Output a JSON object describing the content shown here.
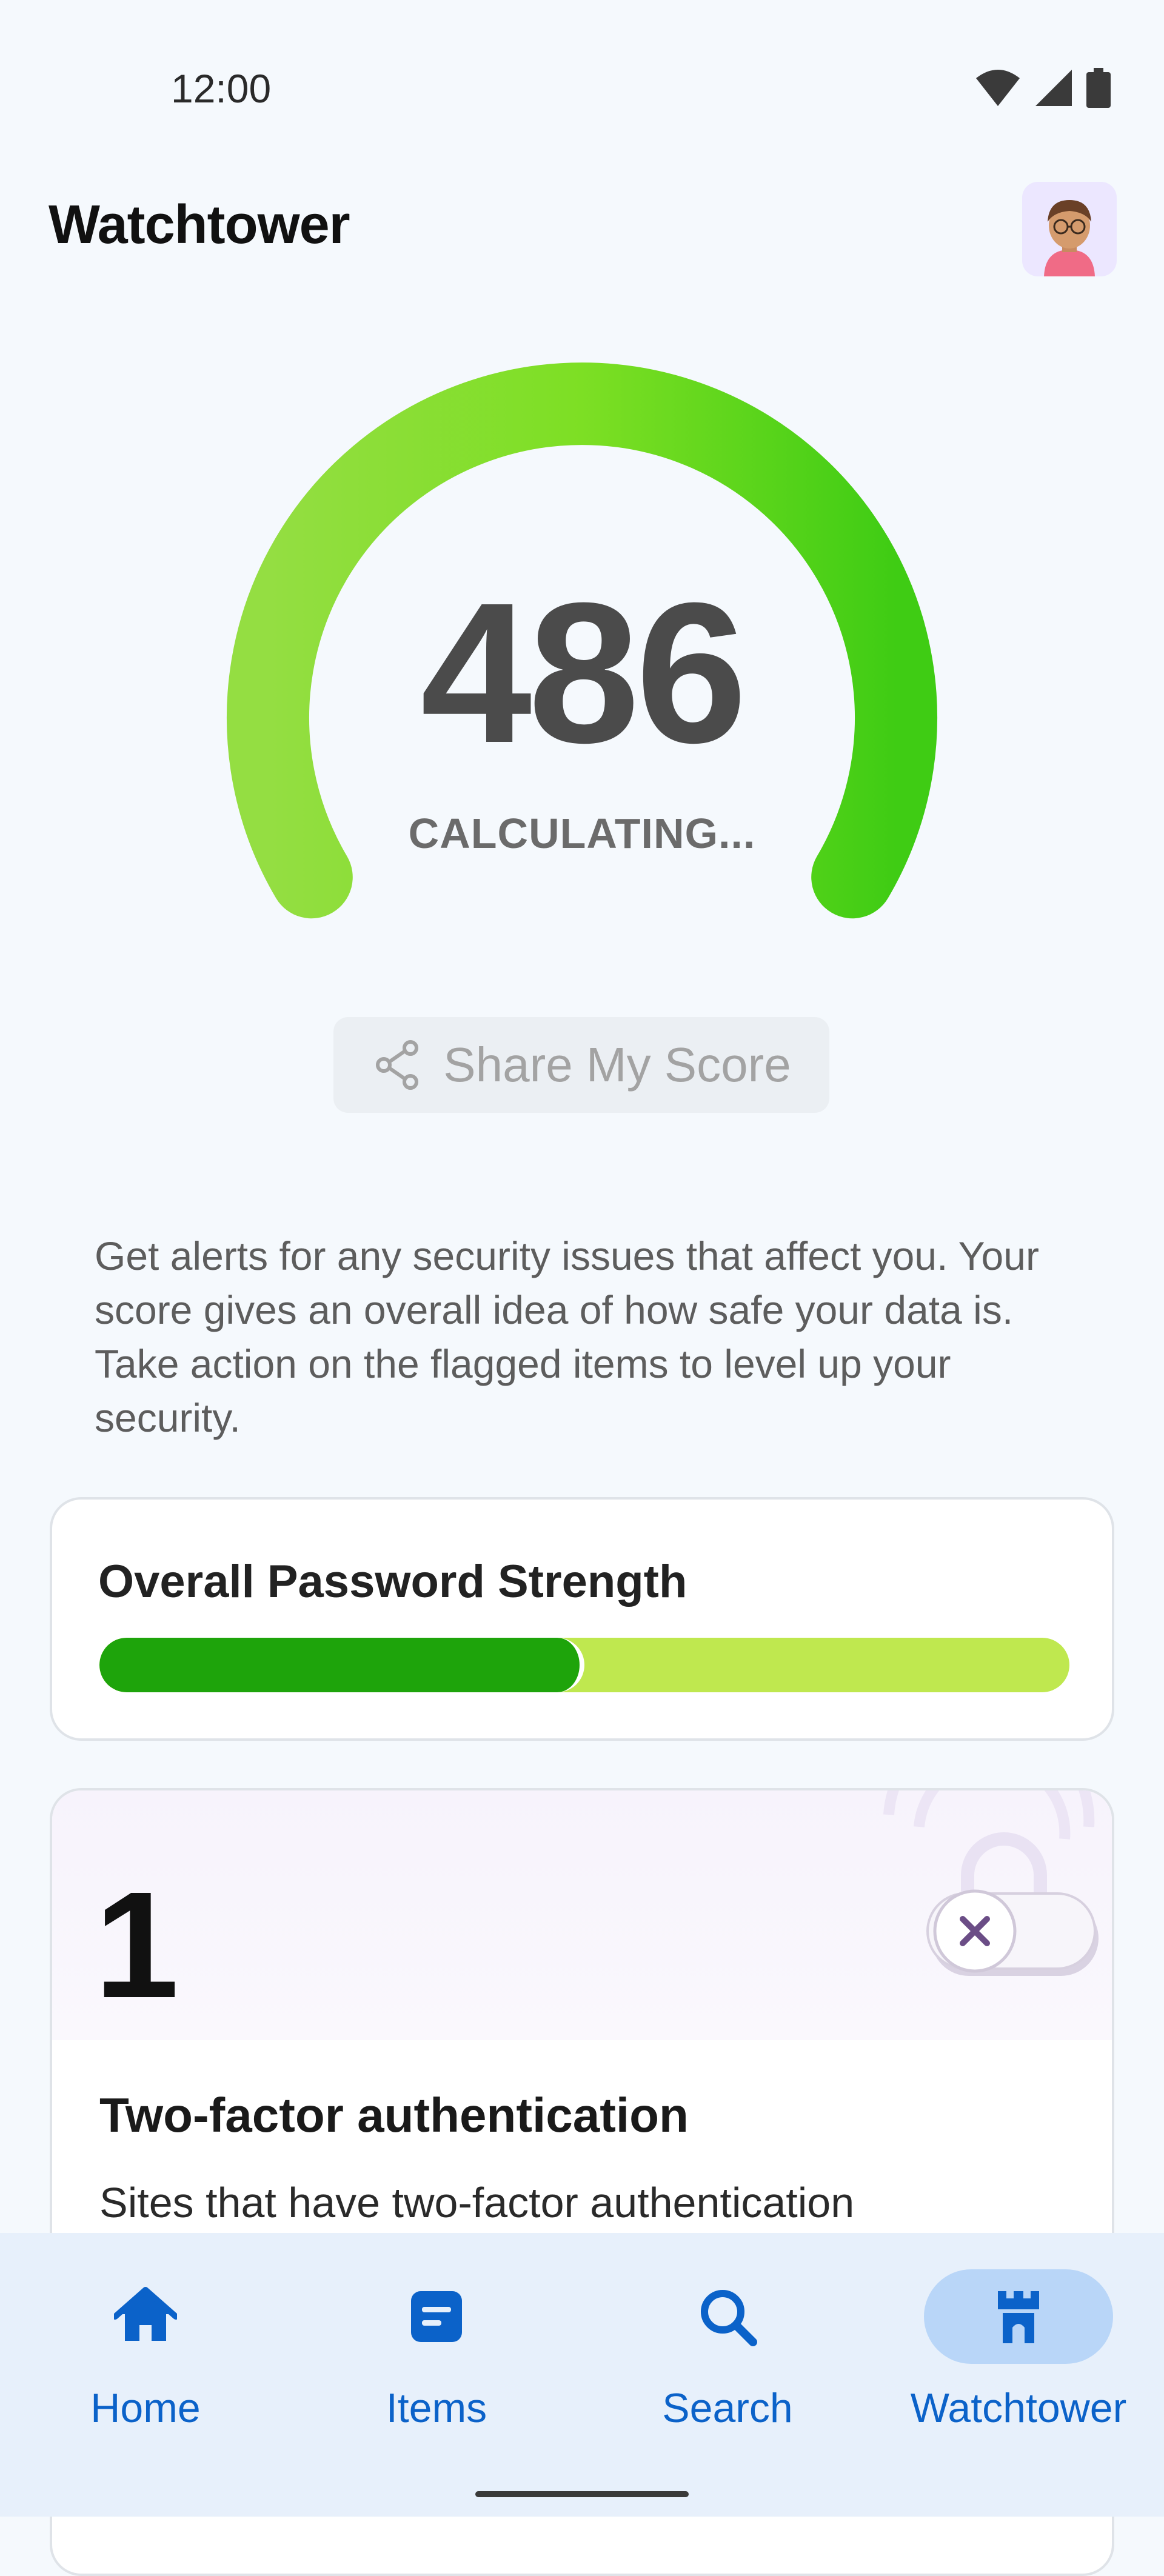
{
  "status_bar": {
    "time": "12:00"
  },
  "header": {
    "title": "Watchtower"
  },
  "score": {
    "value": "486",
    "status": "CALCULATING..."
  },
  "share": {
    "label": "Share My Score"
  },
  "description": "Get alerts for any security issues that affect you. Your score gives an overall idea of how safe your data is. Take action on the flagged items to level up your security.",
  "password_strength": {
    "title": "Overall Password Strength",
    "level": 0.5
  },
  "two_factor": {
    "count": "1",
    "title": "Two-factor authentication",
    "description": "Sites that have two-factor authentication"
  },
  "bottom_nav": {
    "items": [
      {
        "label": "Home",
        "icon": "home-icon"
      },
      {
        "label": "Items",
        "icon": "items-icon"
      },
      {
        "label": "Search",
        "icon": "search-icon"
      },
      {
        "label": "Watchtower",
        "icon": "watchtower-icon"
      }
    ],
    "active": "Watchtower"
  },
  "colors": {
    "accent": "#0b62c9",
    "gauge_start": "#92dc3e",
    "gauge_end": "#3fcc14",
    "strength_fill": "#1ea40b",
    "strength_track": "#bfe84f"
  }
}
